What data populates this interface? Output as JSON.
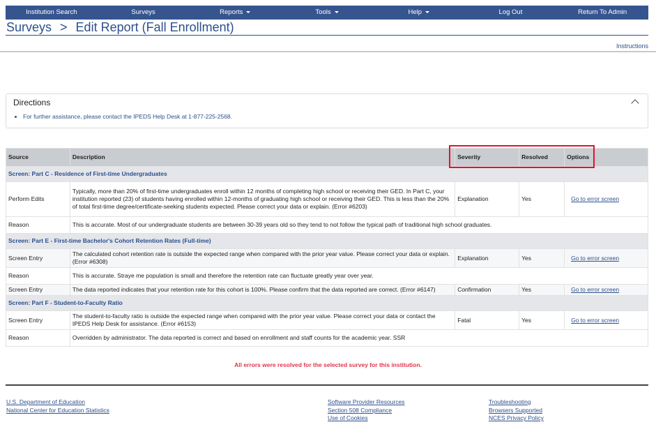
{
  "nav": [
    {
      "label": "Institution Search"
    },
    {
      "label": "Surveys"
    },
    {
      "label": "Reports",
      "dropdown": true
    },
    {
      "label": "Tools",
      "dropdown": true
    },
    {
      "label": "Help",
      "dropdown": true
    },
    {
      "label": "Log Out"
    },
    {
      "label": "Return To Admin"
    }
  ],
  "breadcrumb": {
    "root": "Surveys",
    "sep": ">",
    "current": "Edit Report (Fall Enrollment)"
  },
  "instructions": "Instructions",
  "directions": {
    "title": "Directions",
    "item": "For further assistance, please contact the IPEDS Help Desk at 1-877-225-2568."
  },
  "table": {
    "headers": [
      "Source",
      "Description",
      "Severity",
      "Resolved",
      "Options"
    ],
    "rows": [
      {
        "type": "section",
        "text": "Screen: Part C - Residence of First-time Undergraduates"
      },
      {
        "type": "edit",
        "source": "Perform Edits",
        "description": "Typically, more than 20% of first-time undergraduates enroll within 12 months of completing high school or receiving their GED. In Part C, your institution reported (23) of students having enrolled within 12-months of graduating high school or receiving their GED. This is less than the 20% of total first-time degree/certificate-seeking students expected. Please correct your data or explain. (Error #6203)",
        "severity": "Explanation",
        "resolved": "Yes",
        "option": "Go to error screen"
      },
      {
        "type": "reason",
        "source": "Reason",
        "description": "This is accurate. Most of our undergraduate students are between 30-39 years old so they tend to not follow the typical path of traditional high school graduates."
      },
      {
        "type": "section",
        "text": "Screen: Part E - First-time Bachelor's Cohort Retention Rates (Full-time)"
      },
      {
        "type": "edit",
        "source": "Screen Entry",
        "description": "The calculated cohort retention rate is outside the expected range when compared with the prior year value. Please correct your data or explain. (Error #6308)",
        "severity": "Explanation",
        "resolved": "Yes",
        "option": "Go to error screen"
      },
      {
        "type": "reason",
        "source": "Reason",
        "description": "This is accurate. Straye            me population is small and therefore the retention rate can fluctuate greatly year over year."
      },
      {
        "type": "edit",
        "source": "Screen Entry",
        "description": "The data reported indicates that your retention rate for this cohort is 100%. Please confirm that the data reported are correct. (Error #6147)",
        "severity": "Confirmation",
        "resolved": "Yes",
        "option": "Go to error screen"
      },
      {
        "type": "section",
        "text": "Screen: Part F - Student-to-Faculty Ratio"
      },
      {
        "type": "edit",
        "source": "Screen Entry",
        "description": "The student-to-faculty ratio is outside the expected range when compared with the prior year value. Please correct your data or contact the IPEDS Help Desk for assistance. (Error #6153)",
        "severity": "Fatal",
        "resolved": "Yes",
        "option": "Go to error screen"
      },
      {
        "type": "reason",
        "source": "Reason",
        "description": "Overridden by administrator. The data reported is correct and based on enrollment and staff counts for the academic year. SSR"
      }
    ]
  },
  "status_message": "All errors were resolved for the selected survey for this institution.",
  "footer": {
    "col1": [
      "U.S. Department of Education",
      "National Center for Education Statistics"
    ],
    "col2": [
      "Software Provider Resources",
      "Section 508 Compliance",
      "Use of Cookies"
    ],
    "col3": [
      "Troubleshooting",
      "Browsers Supported",
      "NCES Privacy Policy"
    ]
  },
  "colors": {
    "nav": "#36558f",
    "link": "#2d4f8c",
    "highlight": "#e0142a",
    "status": "#e0364b"
  }
}
